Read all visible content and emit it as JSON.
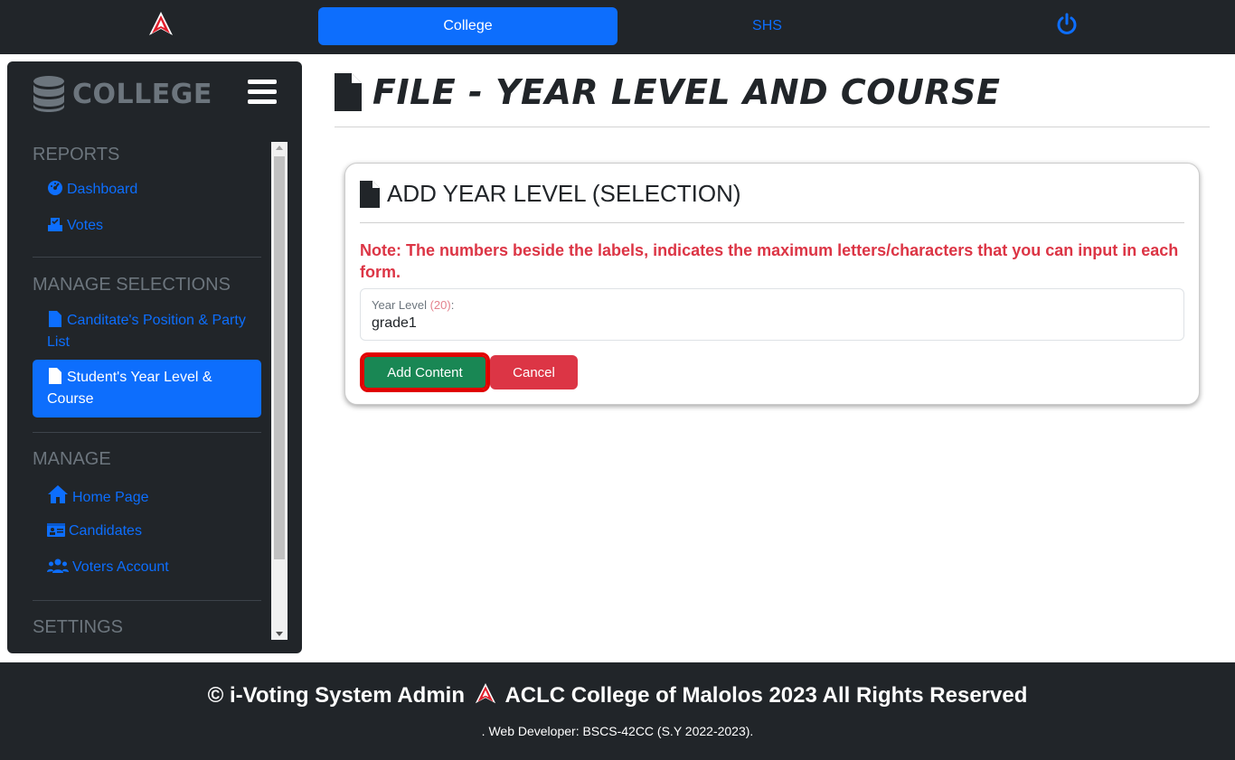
{
  "topbar": {
    "tabs": [
      {
        "label": "College",
        "active": true
      },
      {
        "label": "SHS",
        "active": false
      }
    ],
    "logo_icon": "aclc-logo-icon",
    "power_icon": "power-icon"
  },
  "sidebar": {
    "brand": "COLLEGE",
    "brand_icon": "database-icon",
    "sections": [
      {
        "title": "REPORTS",
        "items": [
          {
            "label": "Dashboard",
            "icon": "dashboard-gauge-icon"
          },
          {
            "label": "Votes",
            "icon": "vote-box-icon"
          }
        ]
      },
      {
        "title": "MANAGE SELECTIONS",
        "items": [
          {
            "label": "Canditate's Position & Party List",
            "icon": "file-icon"
          },
          {
            "label": "Student's Year Level & Course",
            "icon": "file-icon",
            "active": true
          }
        ]
      },
      {
        "title": "MANAGE",
        "items": [
          {
            "label": "Home Page",
            "icon": "home-icon"
          },
          {
            "label": "Candidates",
            "icon": "id-card-icon"
          },
          {
            "label": "Voters Account",
            "icon": "users-icon"
          }
        ]
      },
      {
        "title": "SETTINGS",
        "items": []
      }
    ]
  },
  "main": {
    "page_title": "FILE - YEAR LEVEL AND COURSE",
    "card": {
      "title": "ADD YEAR LEVEL (SELECTION)",
      "note": "Note: The numbers beside the labels, indicates the maximum letters/characters that you can input in each form.",
      "field": {
        "label": "Year Level",
        "max": "(20)",
        "suffix": ":",
        "value": "grade1"
      },
      "add_button": "Add Content",
      "cancel_button": "Cancel"
    }
  },
  "footer": {
    "line1_left": "© i-Voting System Admin",
    "line1_right": "ACLC College of Malolos 2023 All Rights Reserved",
    "line2": ". Web Developer: BSCS-42CC (S.Y 2022-2023)."
  },
  "colors": {
    "accent": "#0d6efd",
    "dark": "#212529",
    "success": "#198754",
    "danger": "#dc3545"
  }
}
